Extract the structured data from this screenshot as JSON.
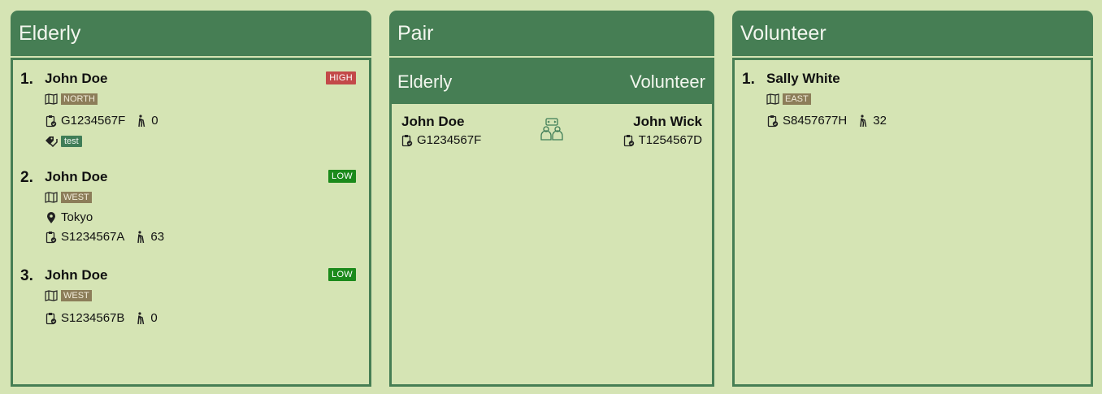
{
  "colors": {
    "background": "#d5e4b4",
    "header": "#467e54",
    "high": "#c34949",
    "low": "#1b8a1b",
    "region": "#8c7d59",
    "tag": "#3f7d57"
  },
  "elderly_panel": {
    "title": "Elderly",
    "items": [
      {
        "index": "1.",
        "name": "John Doe",
        "risk": "HIGH",
        "region": "NORTH",
        "nric": "G1234567F",
        "age": "0",
        "tag": "test"
      },
      {
        "index": "2.",
        "name": "John Doe",
        "risk": "LOW",
        "region": "WEST",
        "address": "Tokyo",
        "nric": "S1234567A",
        "age": "63"
      },
      {
        "index": "3.",
        "name": "John Doe",
        "risk": "LOW",
        "region": "WEST",
        "nric": "S1234567B",
        "age": "0"
      }
    ]
  },
  "pair_panel": {
    "title": "Pair",
    "elderly_header": "Elderly",
    "volunteer_header": "Volunteer",
    "pairs": [
      {
        "elderly_name": "John Doe",
        "elderly_nric": "G1234567F",
        "volunteer_name": "John Wick",
        "volunteer_nric": "T1254567D"
      }
    ]
  },
  "volunteer_panel": {
    "title": "Volunteer",
    "items": [
      {
        "index": "1.",
        "name": "Sally White",
        "region": "EAST",
        "nric": "S8457677H",
        "age": "32"
      }
    ]
  },
  "icons": {
    "region": "map-icon",
    "nric": "id-clipboard-icon",
    "age": "walking-person-icon",
    "address": "location-pin-icon",
    "tag": "tags-icon",
    "pair": "pair-people-icon"
  }
}
